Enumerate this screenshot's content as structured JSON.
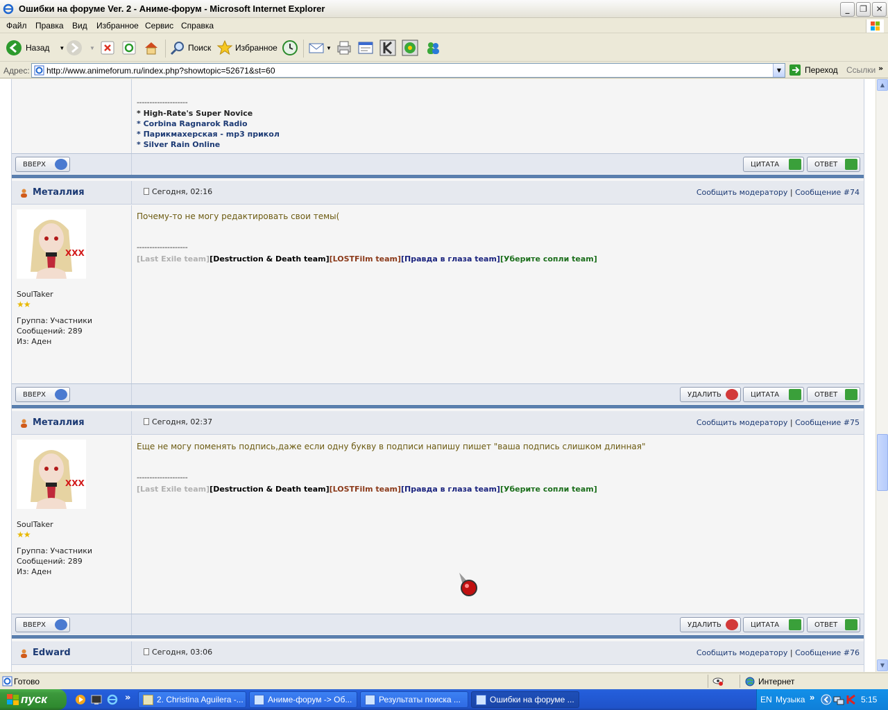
{
  "window": {
    "title": "Ошибки на форуме Ver. 2 - Аниме-форум - Microsoft Internet Explorer"
  },
  "menu": [
    "Файл",
    "Правка",
    "Вид",
    "Избранное",
    "Сервис",
    "Справка"
  ],
  "toolbar": {
    "back": "Назад",
    "search": "Поиск",
    "favorites": "Избранное"
  },
  "address": {
    "label": "Адрес:",
    "url": "http://www.animeforum.ru/index.php?showtopic=52671&st=60",
    "go": "Переход",
    "links": "Ссылки"
  },
  "prev_sig": {
    "dashes": "--------------------",
    "items": [
      "* High-Rate's Super Novice",
      "* Corbina Ragnarok Radio",
      "* Парикмахерская - mp3 прикол",
      "* Silver Rain Online"
    ]
  },
  "buttons": {
    "top": "ВВЕРХ",
    "delete": "УДАЛИТЬ",
    "quote": "ЦИТАТА",
    "reply": "ОТВЕТ"
  },
  "posts": [
    {
      "user": "Металлия",
      "date": "Сегодня, 02:16",
      "report": "Сообщить модератору",
      "sep": "|",
      "num": "Сообщение #74",
      "title": "SoulTaker",
      "group": "Группа: Участники",
      "count": "Сообщений: 289",
      "from": "Из: Аден",
      "message": "Почему-то не могу редактировать свои темы(",
      "avatar_text": "XXX"
    },
    {
      "user": "Металлия",
      "date": "Сегодня, 02:37",
      "report": "Сообщить модератору",
      "sep": "|",
      "num": "Сообщение #75",
      "title": "SoulTaker",
      "group": "Группа: Участники",
      "count": "Сообщений: 289",
      "from": "Из: Аден",
      "message": "Еще не могу поменять подпись,даже если одну букву в подписи напишу пишет \"ваша подпись слишком длинная\"",
      "avatar_text": "XXX"
    },
    {
      "user": "Edward",
      "date": "Сегодня, 03:06",
      "report": "Сообщить модератору",
      "sep": "|",
      "num": "Сообщение #76"
    }
  ],
  "signature": {
    "dashes": "--------------------",
    "parts": [
      "[Last Exile team]",
      "[Destruction & Death team]",
      "[LOSTFilm team]",
      "[Правда в глаза team]",
      "[Уберите сопли team]"
    ],
    "colors": [
      "#b0b0b0",
      "#000000",
      "#8b3a1a",
      "#1a237e",
      "#1b6e1b"
    ]
  },
  "status": {
    "text": "Готово",
    "zone": "Интернет"
  },
  "taskbar": {
    "start": "пуск",
    "tasks": [
      "2. Christina Aguilera -...",
      "Аниме-форум -> Об...",
      "Результаты поиска ...",
      "Ошибки на форуме ..."
    ],
    "lang": "EN",
    "music": "Музыка",
    "time": "5:15"
  }
}
